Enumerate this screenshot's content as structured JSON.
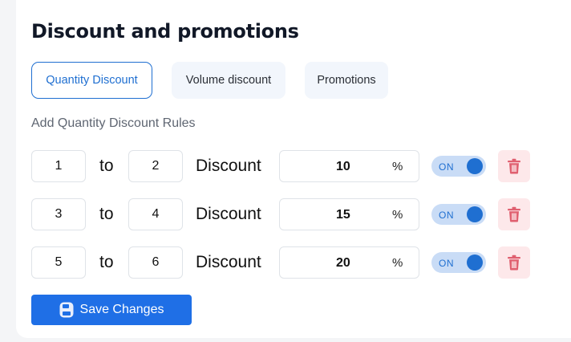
{
  "title": "Discount and promotions",
  "tabs": [
    {
      "label": "Quantity Discount",
      "active": true
    },
    {
      "label": "Volume discount",
      "active": false
    },
    {
      "label": "Promotions",
      "active": false
    }
  ],
  "subtitle": "Add Quantity Discount Rules",
  "rows": [
    {
      "from": "1",
      "to_word": "to",
      "to": "2",
      "discount_word": "Discount",
      "percent": "10",
      "unit": "%",
      "toggle": "ON"
    },
    {
      "from": "3",
      "to_word": "to",
      "to": "4",
      "discount_word": "Discount",
      "percent": "15",
      "unit": "%",
      "toggle": "ON"
    },
    {
      "from": "5",
      "to_word": "to",
      "to": "6",
      "discount_word": "Discount",
      "percent": "20",
      "unit": "%",
      "toggle": "ON"
    }
  ],
  "save_label": "Save Changes",
  "icons": {
    "delete": "trash-icon",
    "save": "save-icon"
  },
  "colors": {
    "accent": "#1f6fe6",
    "delete_bg": "#fde8ea",
    "delete_icon": "#e06070",
    "toggle_bg": "#c9dcf6"
  }
}
